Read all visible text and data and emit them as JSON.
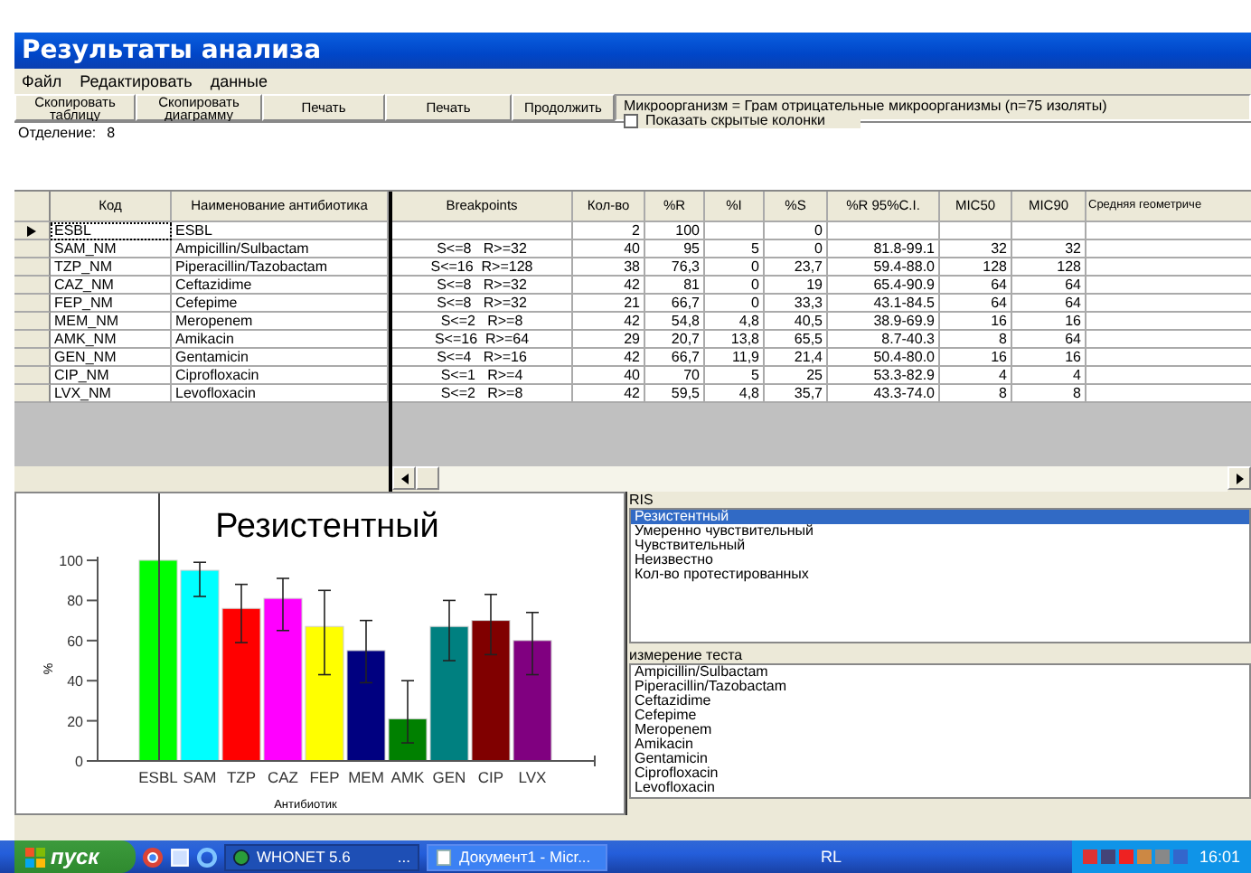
{
  "window": {
    "title": "Результаты анализа"
  },
  "menu": [
    "Файл",
    "Редактировать",
    "данные"
  ],
  "toolbar": {
    "buttons": [
      {
        "label": "Скопировать таблицу"
      },
      {
        "label": "Скопировать диаграмму"
      },
      {
        "label": "Печать"
      },
      {
        "label": "Печать"
      },
      {
        "label": "Продолжить"
      }
    ]
  },
  "organism_info": "Микроорганизм = Грам отрицательные микроорганизмы   (n=75 изоляты)",
  "show_hidden_columns": {
    "label": "Показать скрытые колонки",
    "checked": false
  },
  "department": {
    "label": "Отделение:",
    "value": "8"
  },
  "table": {
    "columns": [
      "Код",
      "Наименование антибиотика",
      "Breakpoints",
      "Кол-во",
      "%R",
      "%I",
      "%S",
      "%R 95%C.I.",
      "MIC50",
      "MIC90",
      "Средняя геометриче"
    ],
    "rows": [
      {
        "selected": true,
        "cells": [
          "ESBL",
          "ESBL",
          "",
          "2",
          "100",
          "",
          "0",
          "",
          "",
          "",
          ""
        ]
      },
      {
        "selected": false,
        "cells": [
          "SAM_NM",
          "Ampicillin/Sulbactam",
          "S<=8   R>=32",
          "40",
          "95",
          "5",
          "0",
          "81.8-99.1",
          "32",
          "32",
          ""
        ]
      },
      {
        "selected": false,
        "cells": [
          "TZP_NM",
          "Piperacillin/Tazobactam",
          "S<=16  R>=128",
          "38",
          "76,3",
          "0",
          "23,7",
          "59.4-88.0",
          "128",
          "128",
          ""
        ]
      },
      {
        "selected": false,
        "cells": [
          "CAZ_NM",
          "Ceftazidime",
          "S<=8   R>=32",
          "42",
          "81",
          "0",
          "19",
          "65.4-90.9",
          "64",
          "64",
          ""
        ]
      },
      {
        "selected": false,
        "cells": [
          "FEP_NM",
          "Cefepime",
          "S<=8   R>=32",
          "21",
          "66,7",
          "0",
          "33,3",
          "43.1-84.5",
          "64",
          "64",
          ""
        ]
      },
      {
        "selected": false,
        "cells": [
          "MEM_NM",
          "Meropenem",
          "S<=2   R>=8",
          "42",
          "54,8",
          "4,8",
          "40,5",
          "38.9-69.9",
          "16",
          "16",
          ""
        ]
      },
      {
        "selected": false,
        "cells": [
          "AMK_NM",
          "Amikacin",
          "S<=16  R>=64",
          "29",
          "20,7",
          "13,8",
          "65,5",
          "8.7-40.3",
          "8",
          "64",
          ""
        ]
      },
      {
        "selected": false,
        "cells": [
          "GEN_NM",
          "Gentamicin",
          "S<=4   R>=16",
          "42",
          "66,7",
          "11,9",
          "21,4",
          "50.4-80.0",
          "16",
          "16",
          ""
        ]
      },
      {
        "selected": false,
        "cells": [
          "CIP_NM",
          "Ciprofloxacin",
          "S<=1   R>=4",
          "40",
          "70",
          "5",
          "25",
          "53.3-82.9",
          "4",
          "4",
          ""
        ]
      },
      {
        "selected": false,
        "cells": [
          "LVX_NM",
          "Levofloxacin",
          "S<=2   R>=8",
          "42",
          "59,5",
          "4,8",
          "35,7",
          "43.3-74.0",
          "8",
          "8",
          ""
        ]
      }
    ]
  },
  "chart_data": {
    "type": "bar",
    "title": "Резистентный",
    "xlabel": "Антибиотик",
    "ylabel": "%",
    "categories": [
      "ESBL",
      "SAM",
      "TZP",
      "CAZ",
      "FEP",
      "MEM",
      "AMK",
      "GEN",
      "CIP",
      "LVX"
    ],
    "series": [
      {
        "colors": [
          "#00ff00",
          "#00ffff",
          "#ff0000",
          "#ff00ff",
          "#ffff00",
          "#000080",
          "#008000",
          "#008080",
          "#800000",
          "#800080"
        ],
        "values": [
          100,
          95,
          76,
          81,
          67,
          55,
          21,
          67,
          70,
          60
        ],
        "errors": [
          null,
          [
            82,
            99
          ],
          [
            59,
            88
          ],
          [
            65,
            91
          ],
          [
            43,
            85
          ],
          [
            39,
            70
          ],
          [
            9,
            40
          ],
          [
            50,
            80
          ],
          [
            53,
            83
          ],
          [
            43,
            74
          ]
        ]
      }
    ],
    "ylim": [
      0,
      100
    ],
    "yticks": [
      0,
      20,
      40,
      60,
      80,
      100
    ]
  },
  "ris_panel": {
    "title": "RIS",
    "items": [
      {
        "label": "Резистентный",
        "selected": true
      },
      {
        "label": "Умеренно чувствительный",
        "selected": false
      },
      {
        "label": "Чувствительный",
        "selected": false
      },
      {
        "label": "Неизвестно",
        "selected": false
      },
      {
        "label": "Кол-во протестированных",
        "selected": false
      }
    ]
  },
  "test_panel": {
    "title": "измерение теста",
    "items": [
      "Ampicillin/Sulbactam",
      "Piperacillin/Tazobactam",
      "Ceftazidime",
      "Cefepime",
      "Meropenem",
      "Amikacin",
      "Gentamicin",
      "Ciprofloxacin",
      "Levofloxacin"
    ]
  },
  "taskbar": {
    "start": "пуск",
    "tasks": [
      {
        "label": "WHONET 5.6",
        "extra": "...",
        "selected": true
      },
      {
        "label": "Документ1 - Micr...",
        "selected": false
      }
    ],
    "language": "RL",
    "clock": "16:01"
  }
}
